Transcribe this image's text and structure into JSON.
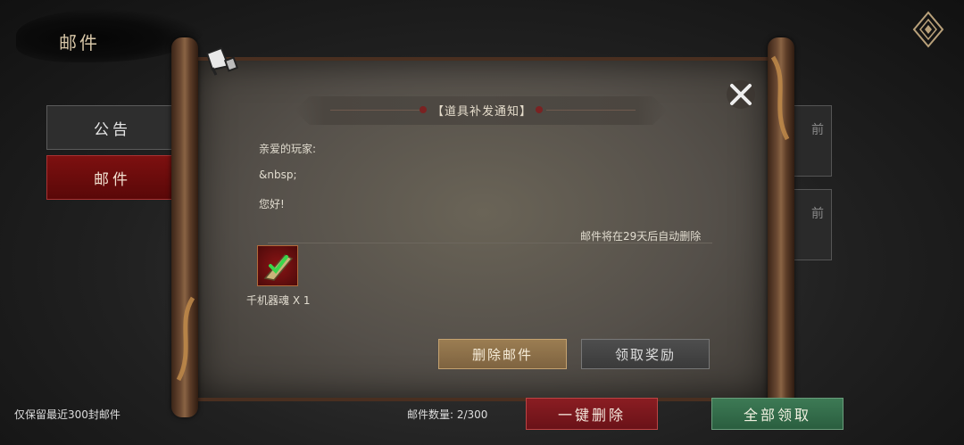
{
  "header": {
    "title": "邮件"
  },
  "tabs": [
    {
      "label": "公告",
      "active": false
    },
    {
      "label": "邮件",
      "active": true
    }
  ],
  "background_cards": {
    "c1_label": "前",
    "c2_label": "前"
  },
  "mail": {
    "title": "【道具补发通知】",
    "greeting": "亲爱的玩家:",
    "line2": "&nbsp;",
    "line3": "您好!",
    "expire_note": "邮件将在29天后自动删除",
    "attachment": {
      "label": "千机器魂 X 1",
      "icon": "item-icon"
    },
    "delete_label": "删除邮件",
    "claim_label": "领取奖励"
  },
  "footer": {
    "note": "仅保留最近300封邮件",
    "count_label": "邮件数量: 2/300",
    "delete_all_label": "一键删除",
    "claim_all_label": "全部领取"
  },
  "colors": {
    "active_tab": "#7d1010",
    "delete_all": "#8a1d22",
    "claim_all": "#3d7a55",
    "delete_mail": "#9b7d52"
  }
}
